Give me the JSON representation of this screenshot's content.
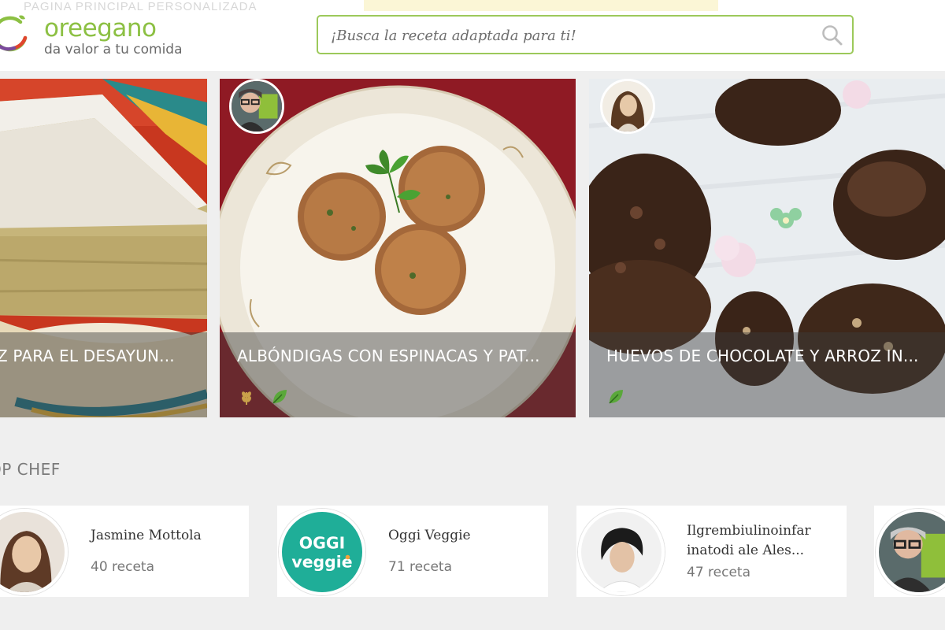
{
  "header": {
    "ghost_text": "PAGINA PRINCIPAL PERSONALIZADA",
    "logo_name": "oreegano",
    "tagline": "da valor a tu comida",
    "search_placeholder": "¡Busca la receta adaptada para ti!",
    "accent_color": "#8cc043"
  },
  "recipes": [
    {
      "title": "OZ PARA EL DESAYUN...",
      "icons": []
    },
    {
      "title": "ALBÓNDIGAS CON ESPINACAS Y PAT...",
      "icons": [
        "wheat-icon",
        "leaf-icon"
      ]
    },
    {
      "title": "HUEVOS DE CHOCOLATE Y ARROZ IN...",
      "icons": [
        "leaf-icon"
      ]
    }
  ],
  "top_chef": {
    "title": "OP CHEF",
    "chefs": [
      {
        "name": "Jasmine Mottola",
        "count": "40 receta"
      },
      {
        "name": "Oggi Veggie",
        "count": "71 receta",
        "logo_text_1": "OGGI",
        "logo_text_2": "veggie"
      },
      {
        "name_line1": "Ilgrembiulinoinfar",
        "name_line2": "inatodi ale Ales...",
        "count": "47 receta"
      }
    ]
  }
}
